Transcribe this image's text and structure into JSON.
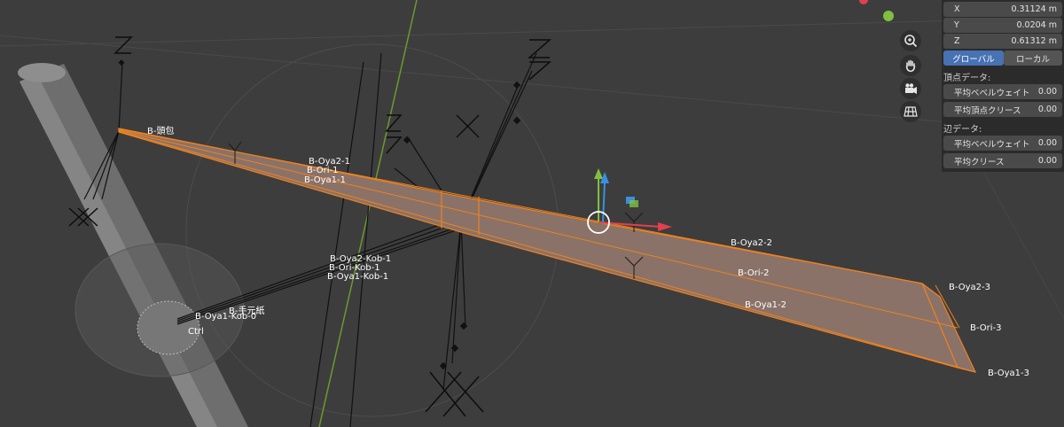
{
  "viewport": {
    "bone_labels": {
      "head": "B-頭包",
      "oya2_1": "B-Oya2-1",
      "ori_1": "B-Ori-1",
      "oya1_1": "B-Oya1-1",
      "oya2_kob_1": "B-Oya2-Kob-1",
      "ori_kob_1": "B-Ori-Kob-1",
      "oya1_kob_1": "B-Oya1-Kob-1",
      "oya_kob_0": "B-Oya1-Kob-0",
      "hand_paper": "B-手元紙",
      "ctrl": "Ctrl",
      "oya2_2": "B-Oya2-2",
      "ori_2": "B-Ori-2",
      "oya1_2": "B-Oya1-2",
      "oya2_3": "B-Oya2-3",
      "ori_3": "B-Ori-3",
      "oya1_3": "B-Oya1-3"
    },
    "colors": {
      "background": "#3d3d3d",
      "selection_orange": "#f0821e",
      "face_fill": "#8a7268",
      "axis_x": "#e04050",
      "axis_y": "#80c040",
      "axis_z": "#3a8fe0"
    }
  },
  "navigation": {
    "zoom_icon": "zoom-magnifier-icon",
    "pan_icon": "hand-pan-icon",
    "camera_icon": "camera-icon",
    "ortho_icon": "grid-ortho-icon"
  },
  "sidebar": {
    "transform": {
      "x_label": "X",
      "x_value": "0.31124 m",
      "y_label": "Y",
      "y_value": "0.0204 m",
      "z_label": "Z",
      "z_value": "0.61312 m"
    },
    "space": {
      "global": "グローバル",
      "local": "ローカル",
      "active": "global"
    },
    "vertex_data": {
      "heading": "頂点データ:",
      "bevel_weight_label": "平均ベベルウェイト",
      "bevel_weight_value": "0.00",
      "crease_label": "平均頂点クリース",
      "crease_value": "0.00"
    },
    "edge_data": {
      "heading": "辺データ:",
      "bevel_weight_label": "平均ベベルウェイト",
      "bevel_weight_value": "0.00",
      "crease_label": "平均クリース",
      "crease_value": "0.00"
    }
  }
}
